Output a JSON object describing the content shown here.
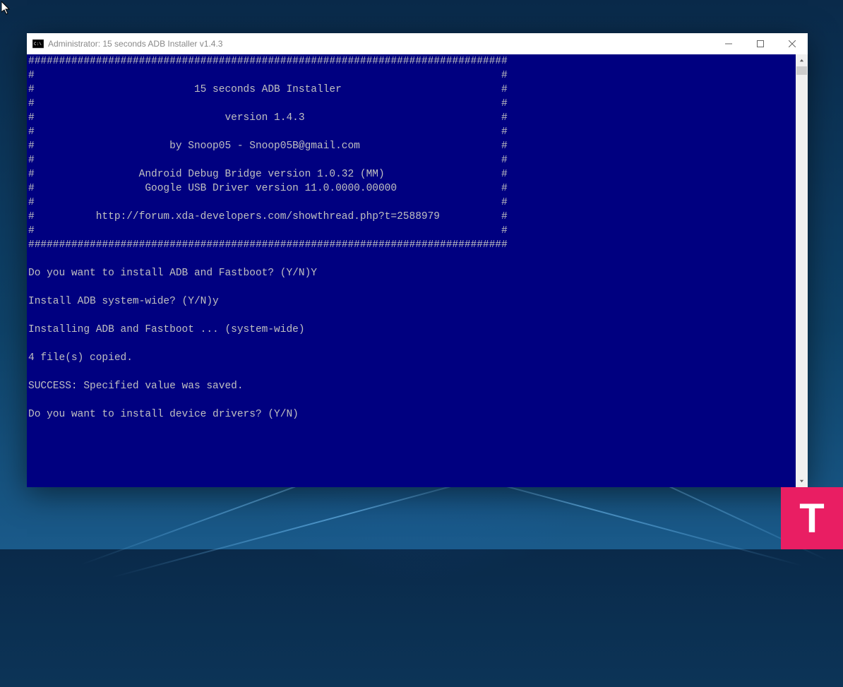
{
  "window": {
    "title": "Administrator:  15 seconds ADB Installer v1.4.3"
  },
  "console": {
    "banner_lines": [
      "##############################################################################",
      "#                                                                            #",
      "#                          15 seconds ADB Installer                          #",
      "#                                                                            #",
      "#                               version 1.4.3                                #",
      "#                                                                            #",
      "#                      by Snoop05 - Snoop05B@gmail.com                       #",
      "#                                                                            #",
      "#                 Android Debug Bridge version 1.0.32 (MM)                   #",
      "#                  Google USB Driver version 11.0.0000.00000                 #",
      "#                                                                            #",
      "#          http://forum.xda-developers.com/showthread.php?t=2588979          #",
      "#                                                                            #",
      "##############################################################################"
    ],
    "body_lines": [
      "",
      "Do you want to install ADB and Fastboot? (Y/N)Y",
      "",
      "Install ADB system-wide? (Y/N)y",
      "",
      "Installing ADB and Fastboot ... (system-wide)",
      "",
      "4 file(s) copied.",
      "",
      "SUCCESS: Specified value was saved.",
      "",
      "Do you want to install device drivers? (Y/N)"
    ]
  },
  "watermark": {
    "letter": "T"
  },
  "colors": {
    "console_bg": "#000080",
    "console_fg": "#c0c0c0",
    "watermark_bg": "#e91e63"
  }
}
